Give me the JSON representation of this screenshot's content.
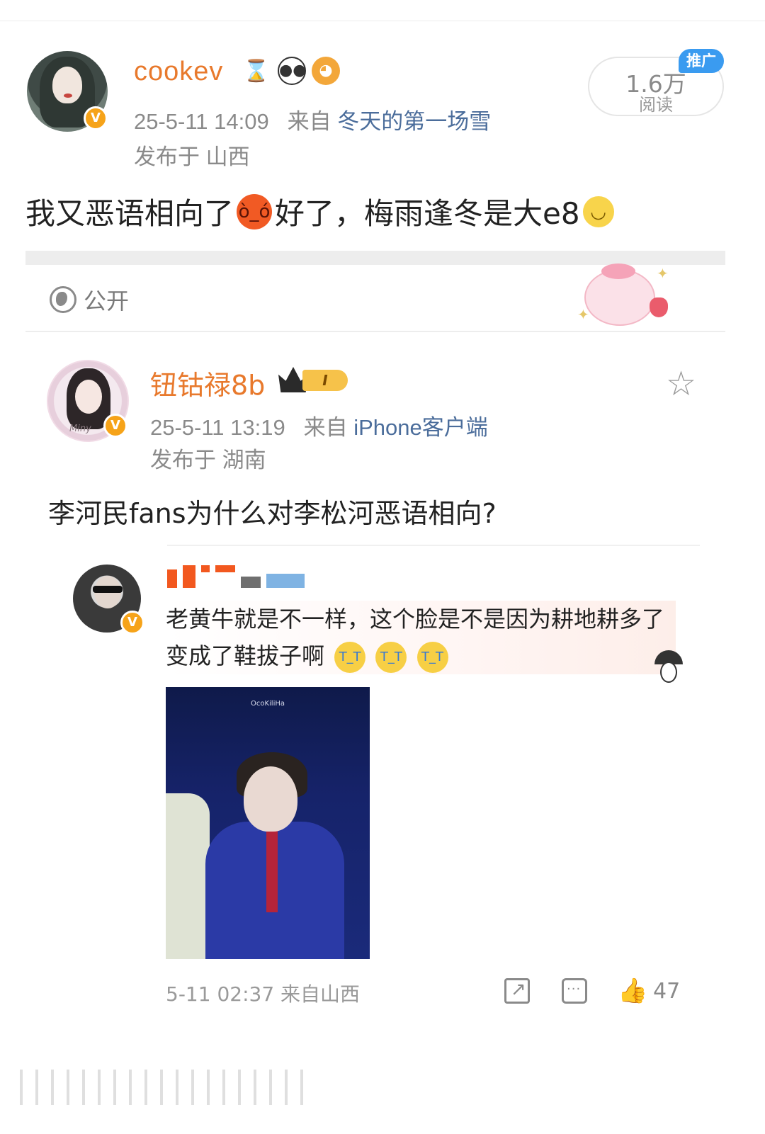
{
  "post": {
    "username": "cookev",
    "timestamp": "25-5-11 14:09",
    "source_prefix": "来自",
    "source": "冬天的第一场雪",
    "location_line": "发布于 山西",
    "read_count": "1.6万",
    "read_label": "阅读",
    "promo_tag": "推广",
    "text_part1": "我又恶语相向了",
    "text_part2": "好了，梅雨逢冬是大e8",
    "visibility": "公开"
  },
  "quoted": {
    "username": "钮钴禄8b",
    "level": "I",
    "timestamp": "25-5-11 13:19",
    "source_prefix": "来自",
    "source": "iPhone客户端",
    "location_line": "发布于 湖南",
    "title": "李河民fans为什么对李松河恶语相向?"
  },
  "reply": {
    "text": "老黄牛就是不一样，这个脸是不是因为耕地耕多了变成了鞋拔子啊",
    "photo_watermark": "OcoKiliHa",
    "footer_meta": "5-11 02:37 来自山西",
    "like_count": "47"
  },
  "colors": {
    "username": "#e8792c",
    "link": "#4b6d9b",
    "meta": "#8a8a8a",
    "promo": "#3a9bf0",
    "verified": "#f6a319"
  },
  "icons": [
    "hourglass-icon",
    "panda-icon",
    "fish-icon",
    "globe-icon",
    "star-icon",
    "share-icon",
    "comment-icon",
    "like-icon"
  ]
}
